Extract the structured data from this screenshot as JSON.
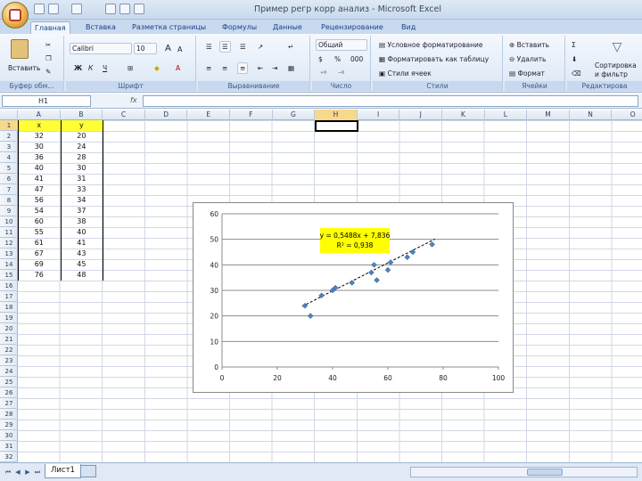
{
  "window": {
    "title": "Пример регр корр анализ - Microsoft Excel"
  },
  "tabs": [
    "Главная",
    "Вставка",
    "Разметка страницы",
    "Формулы",
    "Данные",
    "Рецензирование",
    "Вид"
  ],
  "ribbon": {
    "clipboard": {
      "paste_label": "Вставить",
      "group_label": "Буфер обм..."
    },
    "font": {
      "font_name": "Calibri",
      "font_size": "10",
      "bold": "Ж",
      "italic": "К",
      "underline": "Ч",
      "grow": "A",
      "shrink": "A",
      "group_label": "Шрифт"
    },
    "alignment": {
      "group_label": "Выравнивание"
    },
    "number": {
      "format": "Общий",
      "percent": "%",
      "thousands": "000",
      "group_label": "Число"
    },
    "styles": {
      "conditional": "Условное форматирование",
      "as_table": "Форматировать как таблицу",
      "cell_styles": "Стили ячеек",
      "group_label": "Стили"
    },
    "cells": {
      "insert": "Вставить",
      "delete": "Удалить",
      "format": "Формат",
      "group_label": "Ячейки"
    },
    "editing": {
      "sort": "Сортировка",
      "sort2": "и фильтр",
      "group_label": "Редактирова"
    },
    "accent_color": "#15428b"
  },
  "formula_bar": {
    "name_box": "H1",
    "fx": "fx",
    "value": ""
  },
  "columns": [
    "A",
    "B",
    "C",
    "D",
    "E",
    "F",
    "G",
    "H",
    "I",
    "J",
    "K",
    "L",
    "M",
    "N",
    "O"
  ],
  "selected_column": "H",
  "selected_row": "1",
  "rows": [
    "1",
    "2",
    "3",
    "4",
    "5",
    "6",
    "7",
    "8",
    "9",
    "10",
    "11",
    "12",
    "13",
    "14",
    "15",
    "16",
    "17",
    "18",
    "19",
    "20",
    "21",
    "22",
    "23",
    "24",
    "25",
    "26",
    "27",
    "28",
    "29",
    "30",
    "31",
    "32"
  ],
  "table": {
    "headers": [
      "x",
      "y"
    ],
    "x": [
      "32",
      "30",
      "36",
      "40",
      "41",
      "47",
      "56",
      "54",
      "60",
      "55",
      "61",
      "67",
      "69",
      "76"
    ],
    "y": [
      "20",
      "24",
      "28",
      "30",
      "31",
      "33",
      "34",
      "37",
      "38",
      "40",
      "41",
      "43",
      "45",
      "48"
    ]
  },
  "chart_data": {
    "type": "scatter",
    "x": [
      32,
      30,
      36,
      40,
      41,
      47,
      56,
      54,
      60,
      55,
      61,
      67,
      69,
      76
    ],
    "y": [
      20,
      24,
      28,
      30,
      31,
      33,
      34,
      37,
      38,
      40,
      41,
      43,
      45,
      48
    ],
    "xlim": [
      0,
      100
    ],
    "ylim": [
      0,
      60
    ],
    "xticks": [
      0,
      20,
      40,
      60,
      80,
      100
    ],
    "yticks": [
      0,
      10,
      20,
      30,
      40,
      50,
      60
    ],
    "grid": "horizontal",
    "trendline": {
      "slope": 0.5488,
      "intercept": 7.836,
      "style": "dashed"
    },
    "annotation": {
      "line1": "y = 0,5488x + 7,836",
      "line2": "R² = 0,938"
    },
    "marker_color": "#4f81bd",
    "annotation_bg": "#ffff00"
  },
  "sheet": {
    "active_tab": "Лист1"
  }
}
